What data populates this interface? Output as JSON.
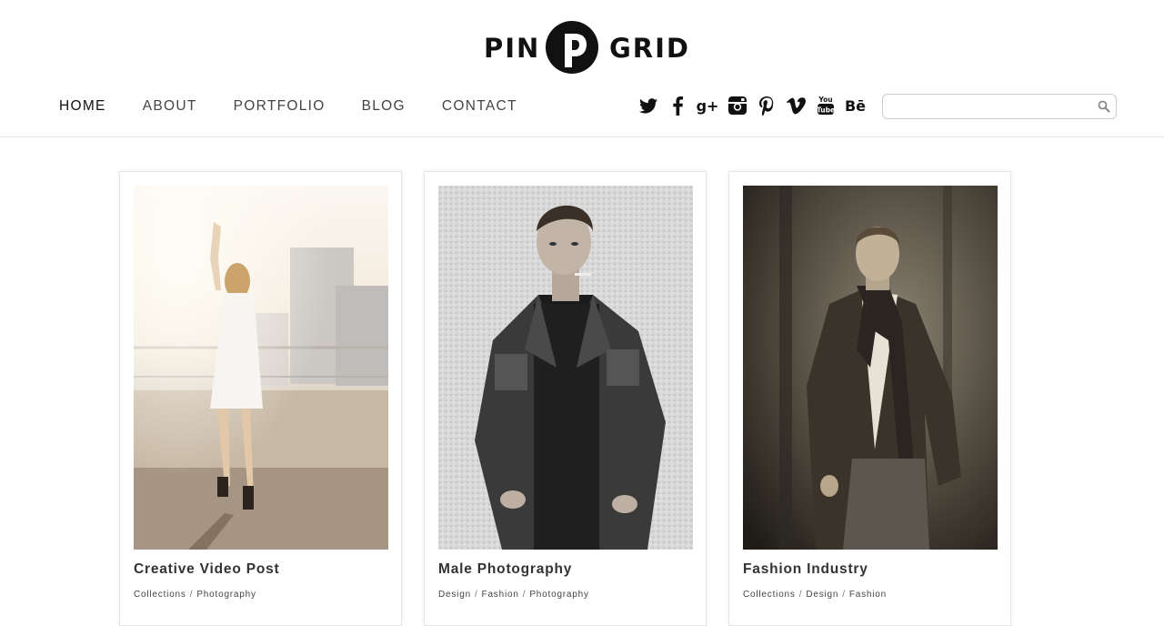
{
  "logo": {
    "left_word": "PIN",
    "right_word": "GRID",
    "mark_letter": "P"
  },
  "nav": {
    "items": [
      {
        "label": "HOME",
        "active": true
      },
      {
        "label": "ABOUT",
        "active": false
      },
      {
        "label": "PORTFOLIO",
        "active": false
      },
      {
        "label": "BLOG",
        "active": false
      },
      {
        "label": "CONTACT",
        "active": false
      }
    ]
  },
  "social": {
    "icons": [
      "twitter-icon",
      "facebook-icon",
      "google-plus-icon",
      "instagram-icon",
      "pinterest-icon",
      "vimeo-icon",
      "youtube-icon",
      "behance-icon"
    ],
    "google_plus_text": "g+",
    "behance_text": "Bē"
  },
  "search": {
    "value": "",
    "placeholder": ""
  },
  "posts": [
    {
      "title": "Creative Video Post",
      "categories": [
        "Collections",
        "Photography"
      ]
    },
    {
      "title": "Male Photography",
      "categories": [
        "Design",
        "Fashion",
        "Photography"
      ]
    },
    {
      "title": "Fashion Industry",
      "categories": [
        "Collections",
        "Design",
        "Fashion"
      ]
    }
  ],
  "colors": {
    "text": "#222222",
    "border": "#e6e6e6",
    "background": "#ffffff"
  }
}
